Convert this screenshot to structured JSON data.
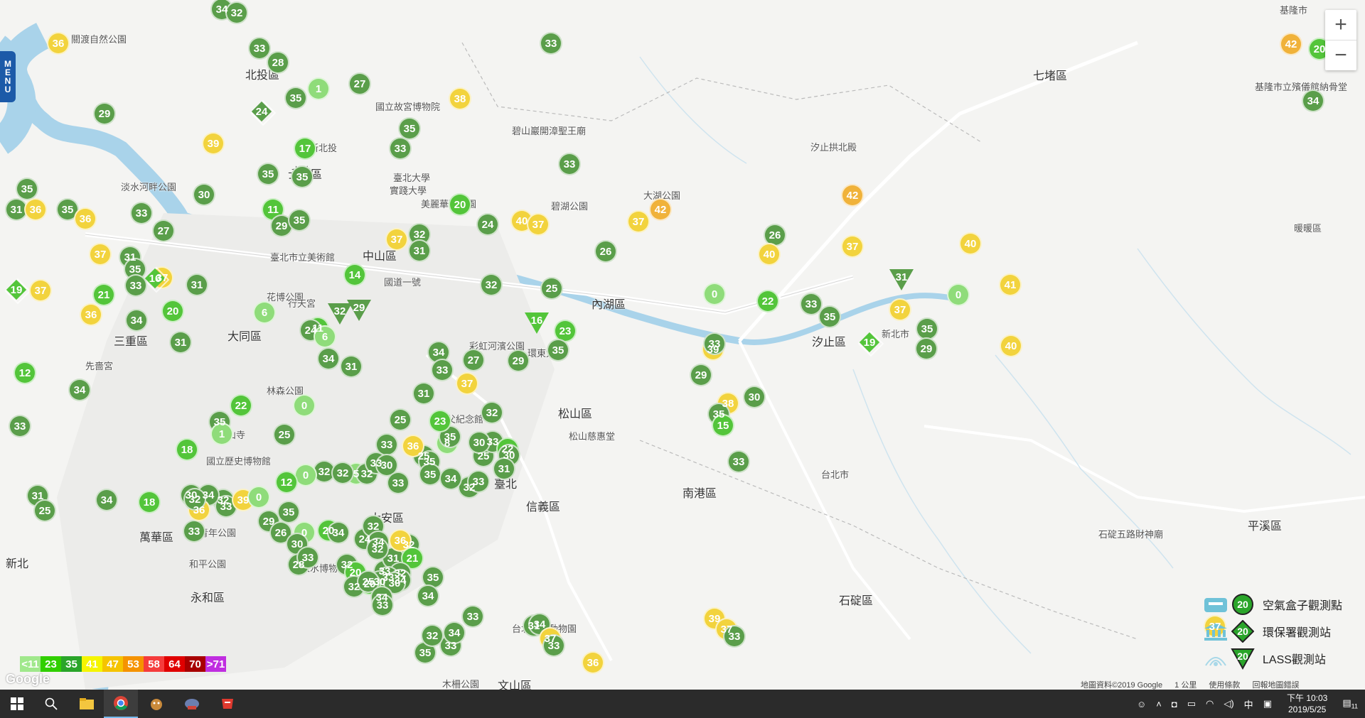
{
  "menu_label": "MENU",
  "zoom": {
    "in_label": "+",
    "out_label": "−"
  },
  "scale_legend": [
    {
      "label": "<11",
      "color": "#a0e88c"
    },
    {
      "label": "23",
      "color": "#31cf00"
    },
    {
      "label": "35",
      "color": "#2aa52a"
    },
    {
      "label": "41",
      "color": "#f5f500"
    },
    {
      "label": "47",
      "color": "#f5c400"
    },
    {
      "label": "53",
      "color": "#f59300"
    },
    {
      "label": "58",
      "color": "#f53c3c"
    },
    {
      "label": "64",
      "color": "#e00000"
    },
    {
      "label": "70",
      "color": "#a80000"
    },
    {
      "label": ">71",
      "color": "#c02ee0"
    }
  ],
  "type_legend": [
    {
      "label": "空氣盒子觀測點",
      "value": "20",
      "icon": "airbox-icon"
    },
    {
      "label": "環保署觀測站",
      "value": "20",
      "icon": "epa-building-icon"
    },
    {
      "label": "LASS觀測站",
      "value": "20",
      "icon": "lass-antenna-icon"
    }
  ],
  "place_labels": [
    "北投區",
    "士林區",
    "大同區",
    "中山區",
    "內湖區",
    "松山區",
    "信義區",
    "南港區",
    "汐止區",
    "七堵區",
    "萬華區",
    "永和區",
    "大安區",
    "文山區",
    "三重區",
    "石碇區",
    "平溪區",
    "木柵公園",
    "國立故宮博物院",
    "碧山巖開漳聖王廟",
    "碧湖公園",
    "大湖公園",
    "彩虹河濱公園",
    "林森公園",
    "國立歷史博物館",
    "青年公園",
    "和平公園",
    "自來水博物館",
    "台北市立動物園",
    "石碇五路財神廟",
    "基隆市立殯儀館納骨堂",
    "暖暖區",
    "淡水河畔公園",
    "先嗇宮",
    "臺北市立美術館",
    "花博公園",
    "行天宮",
    "國道一號",
    "環東大道",
    "松山慈惠堂",
    "實踐大學",
    "美麗華百樂園",
    "汐止拱北殿",
    "新北市",
    "台北市",
    "基隆市",
    "關渡自然公園",
    "新北",
    "臺北",
    "龍山寺",
    "國父紀念館",
    "臺北大學",
    "新北投",
    "士林"
  ],
  "markers": [
    {
      "v": "34",
      "t": "c"
    },
    {
      "v": "32",
      "t": "c"
    },
    {
      "v": "36",
      "t": "c"
    },
    {
      "v": "33",
      "t": "c"
    },
    {
      "v": "28",
      "t": "c"
    },
    {
      "v": "33",
      "t": "c"
    },
    {
      "v": "1",
      "t": "c"
    },
    {
      "v": "27",
      "t": "c"
    },
    {
      "v": "35",
      "t": "c"
    },
    {
      "v": "38",
      "t": "c"
    },
    {
      "v": "29",
      "t": "c"
    },
    {
      "v": "24",
      "t": "d"
    },
    {
      "v": "39",
      "t": "c"
    },
    {
      "v": "35",
      "t": "c"
    },
    {
      "v": "17",
      "t": "c"
    },
    {
      "v": "33",
      "t": "c"
    },
    {
      "v": "33",
      "t": "c"
    },
    {
      "v": "35",
      "t": "c"
    },
    {
      "v": "30",
      "t": "c"
    },
    {
      "v": "35",
      "t": "c"
    },
    {
      "v": "35",
      "t": "c"
    },
    {
      "v": "31",
      "t": "c"
    },
    {
      "v": "36",
      "t": "c"
    },
    {
      "v": "35",
      "t": "c"
    },
    {
      "v": "36",
      "t": "c"
    },
    {
      "v": "33",
      "t": "c"
    },
    {
      "v": "27",
      "t": "c"
    },
    {
      "v": "11",
      "t": "c"
    },
    {
      "v": "29",
      "t": "c"
    },
    {
      "v": "35",
      "t": "c"
    },
    {
      "v": "20",
      "t": "c"
    },
    {
      "v": "24",
      "t": "c"
    },
    {
      "v": "40",
      "t": "c"
    },
    {
      "v": "37",
      "t": "c"
    },
    {
      "v": "37",
      "t": "c"
    },
    {
      "v": "42",
      "t": "c"
    },
    {
      "v": "37",
      "t": "c"
    },
    {
      "v": "32",
      "t": "c"
    },
    {
      "v": "31",
      "t": "c"
    },
    {
      "v": "26",
      "t": "c"
    },
    {
      "v": "26",
      "t": "c"
    },
    {
      "v": "40",
      "t": "c"
    },
    {
      "v": "42",
      "t": "c"
    },
    {
      "v": "37",
      "t": "c"
    },
    {
      "v": "31",
      "t": "c"
    },
    {
      "v": "35",
      "t": "c"
    },
    {
      "v": "37",
      "t": "c"
    },
    {
      "v": "16",
      "t": "d"
    },
    {
      "v": "31",
      "t": "c"
    },
    {
      "v": "21",
      "t": "c"
    },
    {
      "v": "19",
      "t": "d"
    },
    {
      "v": "33",
      "t": "c"
    },
    {
      "v": "37",
      "t": "c"
    },
    {
      "v": "36",
      "t": "c"
    },
    {
      "v": "34",
      "t": "c"
    },
    {
      "v": "20",
      "t": "c"
    },
    {
      "v": "31",
      "t": "c"
    },
    {
      "v": "14",
      "t": "c"
    },
    {
      "v": "32",
      "t": "c"
    },
    {
      "v": "25",
      "t": "c"
    },
    {
      "v": "23",
      "t": "c"
    },
    {
      "v": "37",
      "t": "c"
    },
    {
      "v": "0",
      "t": "c"
    },
    {
      "v": "22",
      "t": "c"
    },
    {
      "v": "33",
      "t": "c"
    },
    {
      "v": "35",
      "t": "c"
    },
    {
      "v": "37",
      "t": "c"
    },
    {
      "v": "35",
      "t": "c"
    },
    {
      "v": "0",
      "t": "c"
    },
    {
      "v": "40",
      "t": "c"
    },
    {
      "v": "41",
      "t": "c"
    },
    {
      "v": "40",
      "t": "c"
    },
    {
      "v": "31",
      "t": "t"
    },
    {
      "v": "29",
      "t": "c"
    },
    {
      "v": "19",
      "t": "d"
    },
    {
      "v": "11",
      "t": "c"
    },
    {
      "v": "6",
      "t": "c"
    },
    {
      "v": "24",
      "t": "c"
    },
    {
      "v": "6",
      "t": "c"
    },
    {
      "v": "29",
      "t": "t"
    },
    {
      "v": "32",
      "t": "t"
    },
    {
      "v": "34",
      "t": "c"
    },
    {
      "v": "31",
      "t": "c"
    },
    {
      "v": "34",
      "t": "c"
    },
    {
      "v": "29",
      "t": "c"
    },
    {
      "v": "16",
      "t": "t"
    },
    {
      "v": "35",
      "t": "c"
    },
    {
      "v": "31",
      "t": "c"
    },
    {
      "v": "37",
      "t": "c"
    },
    {
      "v": "27",
      "t": "c"
    },
    {
      "v": "33",
      "t": "c"
    },
    {
      "v": "39",
      "t": "c"
    },
    {
      "v": "29",
      "t": "c"
    },
    {
      "v": "38",
      "t": "c"
    },
    {
      "v": "35",
      "t": "c"
    },
    {
      "v": "30",
      "t": "c"
    },
    {
      "v": "15",
      "t": "c"
    },
    {
      "v": "33",
      "t": "c"
    },
    {
      "v": "33",
      "t": "c"
    },
    {
      "v": "34",
      "t": "c"
    },
    {
      "v": "33",
      "t": "c"
    },
    {
      "v": "12",
      "t": "c"
    },
    {
      "v": "35",
      "t": "c"
    },
    {
      "v": "22",
      "t": "c"
    },
    {
      "v": "0",
      "t": "c"
    },
    {
      "v": "25",
      "t": "c"
    },
    {
      "v": "25",
      "t": "c"
    },
    {
      "v": "8",
      "t": "c"
    },
    {
      "v": "35",
      "t": "c"
    },
    {
      "v": "25",
      "t": "c"
    },
    {
      "v": "33",
      "t": "c"
    },
    {
      "v": "32",
      "t": "c"
    },
    {
      "v": "30",
      "t": "c"
    },
    {
      "v": "22",
      "t": "c"
    },
    {
      "v": "18",
      "t": "c"
    },
    {
      "v": "1",
      "t": "c"
    },
    {
      "v": "25",
      "t": "c"
    },
    {
      "v": "32",
      "t": "c"
    },
    {
      "v": "5",
      "t": "c"
    },
    {
      "v": "0",
      "t": "c"
    },
    {
      "v": "12",
      "t": "c"
    },
    {
      "v": "32",
      "t": "c"
    },
    {
      "v": "32",
      "t": "c"
    },
    {
      "v": "33",
      "t": "c"
    },
    {
      "v": "23",
      "t": "c"
    },
    {
      "v": "36",
      "t": "c"
    },
    {
      "v": "33",
      "t": "c"
    },
    {
      "v": "30",
      "t": "c"
    },
    {
      "v": "33",
      "t": "c"
    },
    {
      "v": "35",
      "t": "c"
    },
    {
      "v": "32",
      "t": "c"
    },
    {
      "v": "30",
      "t": "c"
    },
    {
      "v": "33",
      "t": "c"
    },
    {
      "v": "35",
      "t": "c"
    },
    {
      "v": "34",
      "t": "c"
    },
    {
      "v": "31",
      "t": "c"
    },
    {
      "v": "31",
      "t": "c"
    },
    {
      "v": "25",
      "t": "c"
    },
    {
      "v": "34",
      "t": "c"
    },
    {
      "v": "18",
      "t": "c"
    },
    {
      "v": "30",
      "t": "c"
    },
    {
      "v": "32",
      "t": "c"
    },
    {
      "v": "33",
      "t": "c"
    },
    {
      "v": "39",
      "t": "c"
    },
    {
      "v": "0",
      "t": "c"
    },
    {
      "v": "33",
      "t": "c"
    },
    {
      "v": "34",
      "t": "c"
    },
    {
      "v": "36",
      "t": "c"
    },
    {
      "v": "35",
      "t": "c"
    },
    {
      "v": "29",
      "t": "c"
    },
    {
      "v": "32",
      "t": "c"
    },
    {
      "v": "26",
      "t": "c"
    },
    {
      "v": "0",
      "t": "c"
    },
    {
      "v": "30",
      "t": "c"
    },
    {
      "v": "20",
      "t": "c"
    },
    {
      "v": "34",
      "t": "c"
    },
    {
      "v": "24",
      "t": "c"
    },
    {
      "v": "28",
      "t": "c"
    },
    {
      "v": "33",
      "t": "c"
    },
    {
      "v": "32",
      "t": "c"
    },
    {
      "v": "31",
      "t": "c"
    },
    {
      "v": "21",
      "t": "c"
    },
    {
      "v": "32",
      "t": "c"
    },
    {
      "v": "33",
      "t": "c"
    },
    {
      "v": "35",
      "t": "c"
    },
    {
      "v": "32",
      "t": "c"
    },
    {
      "v": "34",
      "t": "c"
    },
    {
      "v": "33",
      "t": "c"
    },
    {
      "v": "32",
      "t": "c"
    },
    {
      "v": "20",
      "t": "c"
    },
    {
      "v": "30",
      "t": "c"
    },
    {
      "v": "34",
      "t": "c"
    },
    {
      "v": "20",
      "t": "c"
    },
    {
      "v": "32",
      "t": "c"
    },
    {
      "v": "30",
      "t": "c"
    },
    {
      "v": "36",
      "t": "c"
    },
    {
      "v": "32",
      "t": "c"
    },
    {
      "v": "25",
      "t": "c"
    },
    {
      "v": "34",
      "t": "c"
    },
    {
      "v": "33",
      "t": "c"
    },
    {
      "v": "34",
      "t": "c"
    },
    {
      "v": "35",
      "t": "c"
    },
    {
      "v": "33",
      "t": "c"
    },
    {
      "v": "32",
      "t": "c"
    },
    {
      "v": "34",
      "t": "c"
    },
    {
      "v": "33",
      "t": "c"
    },
    {
      "v": "31",
      "t": "c"
    },
    {
      "v": "34",
      "t": "c"
    },
    {
      "v": "37",
      "t": "c"
    },
    {
      "v": "33",
      "t": "c"
    },
    {
      "v": "36",
      "t": "c"
    },
    {
      "v": "39",
      "t": "c"
    },
    {
      "v": "37",
      "t": "c"
    },
    {
      "v": "33",
      "t": "c"
    },
    {
      "v": "37",
      "t": "c"
    },
    {
      "v": "42",
      "t": "c"
    },
    {
      "v": "20",
      "t": "c"
    },
    {
      "v": "34",
      "t": "c"
    }
  ],
  "attribution": {
    "data": "地圖資料©2019 Google",
    "scale": "1 公里",
    "terms": "使用條款",
    "report": "回報地圖錯誤"
  },
  "google_logo": "Google",
  "taskbar": {
    "start_icon": "windows-start-icon",
    "search_icon": "search-icon",
    "apps": [
      "file-explorer-icon",
      "chrome-icon",
      "app-icon-1",
      "app-icon-2",
      "app-icon-3"
    ],
    "ime": "中",
    "time": "下午 10:03",
    "date": "2019/5/25",
    "notifications": "11"
  }
}
